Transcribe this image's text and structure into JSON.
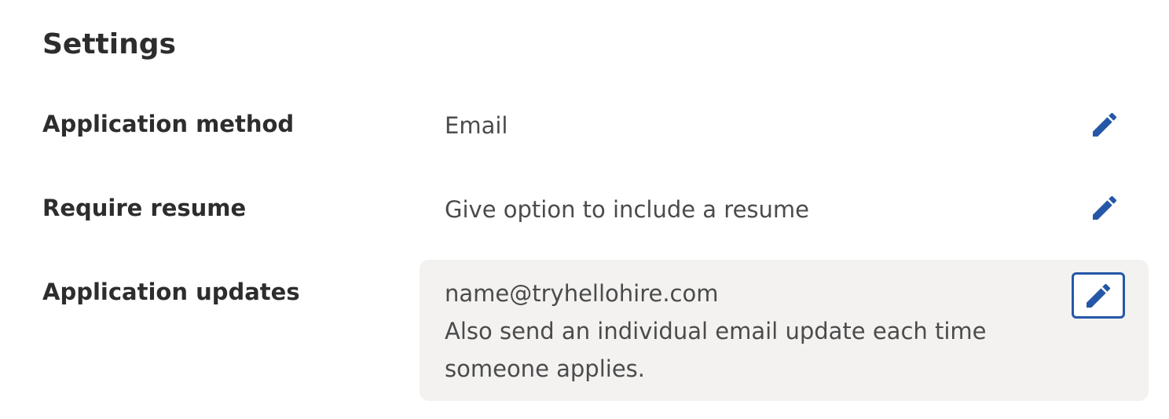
{
  "settings": {
    "title": "Settings",
    "rows": [
      {
        "label": "Application method",
        "value": "Email",
        "edit_icon": "pencil-icon"
      },
      {
        "label": "Require resume",
        "value": "Give option to include a resume",
        "edit_icon": "pencil-icon"
      },
      {
        "label": "Application updates",
        "values": [
          "name@tryhellohire.com",
          "Also send an individual email update each time",
          "someone applies."
        ],
        "edit_icon": "pencil-icon",
        "highlighted": true
      }
    ]
  },
  "colors": {
    "accent": "#2557a7",
    "text": "#2d2d2d",
    "muted_text": "#4b4b4b",
    "highlight_bg": "#f3f2f1"
  }
}
